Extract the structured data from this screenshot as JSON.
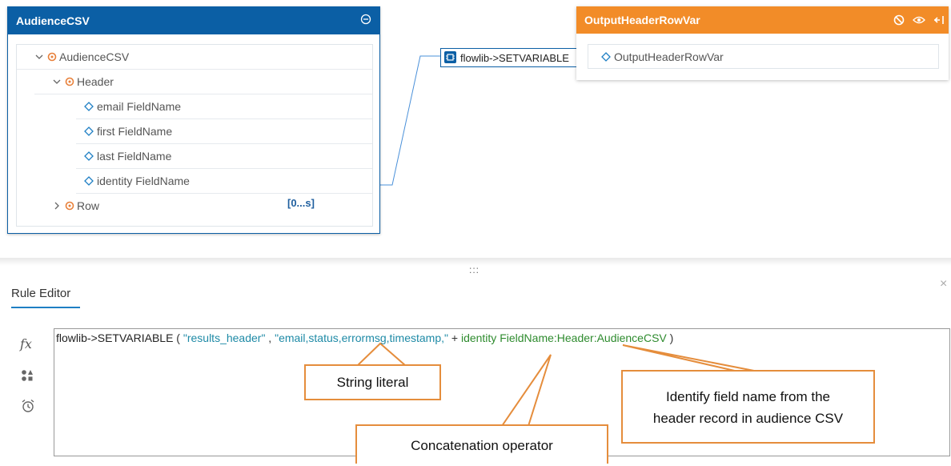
{
  "source_panel": {
    "title": "AudienceCSV",
    "tree": {
      "root": "AudienceCSV",
      "header": "Header",
      "fields": [
        "email FieldName",
        "first FieldName",
        "last FieldName",
        "identity FieldName"
      ],
      "row": "Row",
      "row_range": "[0...s]"
    }
  },
  "function_node": {
    "label": "flowlib->SETVARIABLE"
  },
  "target_panel": {
    "title": "OutputHeaderRowVar",
    "field": "OutputHeaderRowVar"
  },
  "divider_grip": ":::",
  "rule_editor": {
    "title": "Rule Editor",
    "close": "×",
    "fx": "fx",
    "expression": {
      "fn": "flowlib->SETVARIABLE",
      "open": " ( ",
      "arg1": "\"results_header\"",
      "comma": " , ",
      "arg2": "\"email,status,errormsg,timestamp,\"",
      "plus": " + ",
      "arg3": "identity FieldName:Header:AudienceCSV",
      "close": " )"
    }
  },
  "callouts": {
    "string_literal": "String literal",
    "concat": "Concatenation operator",
    "identify_line1": "Identify field name from the",
    "identify_line2": "header record in audience CSV"
  },
  "colors": {
    "source_header": "#0b5fa5",
    "target_header": "#f28c28",
    "callout_border": "#e58d3c",
    "link_line": "#4a90d9"
  }
}
